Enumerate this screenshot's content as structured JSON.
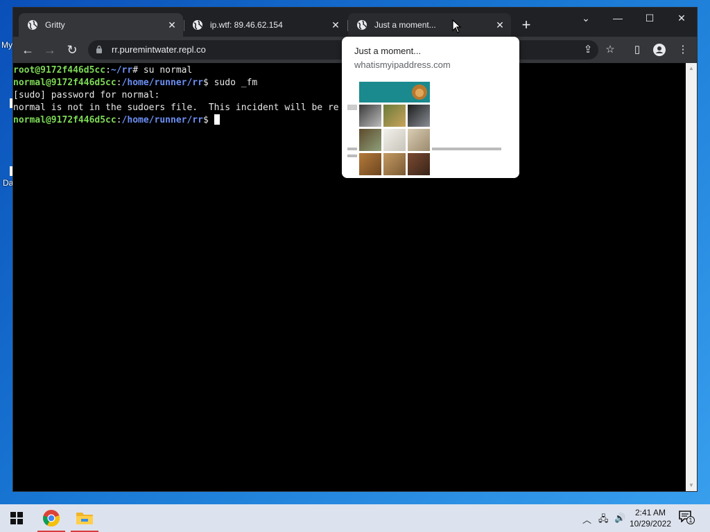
{
  "desktop": {
    "icon_label_1": "My",
    "icon_label_2": "Da"
  },
  "browser": {
    "tabs": [
      {
        "title": "Gritty",
        "active": true
      },
      {
        "title": "ip.wtf: 89.46.62.154",
        "active": false
      },
      {
        "title": "Just a moment...",
        "active": false
      }
    ],
    "address": "rr.puremintwater.repl.co",
    "hover_card": {
      "title": "Just a moment...",
      "domain": "whatismyipaddress.com"
    }
  },
  "terminal": {
    "lines": [
      {
        "user": "root@9172f446d5cc",
        "sep": ":",
        "path": "~/rr",
        "prompt": "# ",
        "cmd": "su normal"
      },
      {
        "user": "normal@9172f446d5cc",
        "sep": ":",
        "path": "/home/runner/rr",
        "prompt": "$ ",
        "cmd": "sudo _fm"
      },
      {
        "text": "[sudo] password for normal:"
      },
      {
        "text": "normal is not in the sudoers file.  This incident will be re"
      },
      {
        "user": "normal@9172f446d5cc",
        "sep": ":",
        "path": "/home/runner/rr",
        "prompt": "$ ",
        "cmd": ""
      }
    ]
  },
  "taskbar": {
    "apps": [
      {
        "icon": "chrome-icon",
        "running": true
      },
      {
        "icon": "file-explorer-icon",
        "running": true
      }
    ],
    "clock": {
      "time": "2:41 AM",
      "date": "10/29/2022"
    },
    "notification_count": "1"
  },
  "colors": {
    "user_green": "#7ed957",
    "path_blue": "#6b8ff4",
    "tab_active": "#35363a"
  }
}
